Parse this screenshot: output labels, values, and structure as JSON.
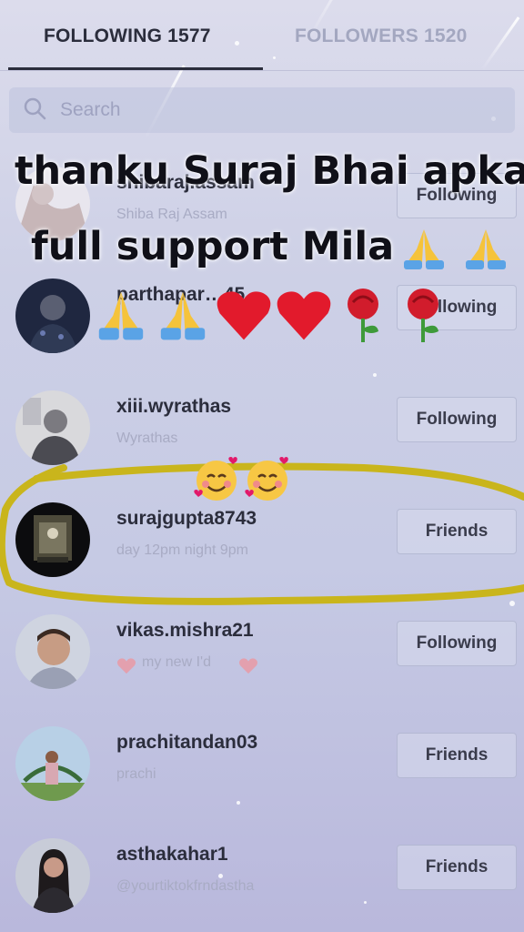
{
  "tabs": {
    "following": "FOLLOWING 1577",
    "followers": "FOLLOWERS 1520"
  },
  "search": {
    "placeholder": "Search"
  },
  "users": [
    {
      "username": "shibaraj.assam",
      "nickname": "Shiba Raj Assam",
      "action": "Following"
    },
    {
      "username": "parthapar…45",
      "nickname": "",
      "action": "Following"
    },
    {
      "username": "xiii.wyrathas",
      "nickname": "Wyrathas",
      "action": "Following"
    },
    {
      "username": "surajgupta8743",
      "nickname": "day 12pm  night 9pm",
      "action": "Friends"
    },
    {
      "username": "vikas.mishra21",
      "nickname": "my new I'd",
      "action": "Following"
    },
    {
      "username": "prachitandan03",
      "nickname": "prachi",
      "action": "Friends"
    },
    {
      "username": "asthakahar1",
      "nickname": "@yourtiktokfrndastha",
      "action": "Friends"
    }
  ],
  "overlay": {
    "line1": "thanku Suraj Bhai apka",
    "line2": "full support Mila",
    "emojis_line2": [
      "folded-hands",
      "folded-hands"
    ],
    "emojis_line3": [
      "folded-hands",
      "folded-hands",
      "red-heart",
      "red-heart",
      "rose",
      "rose"
    ],
    "emojis_highlight": [
      "smiling-face-with-hearts",
      "smiling-face-with-hearts"
    ]
  },
  "colors": {
    "highlight": "#c9b51c",
    "heart": "#e21a2c",
    "text_dark": "#2b2d3c",
    "text_muted": "#a8abc4"
  }
}
